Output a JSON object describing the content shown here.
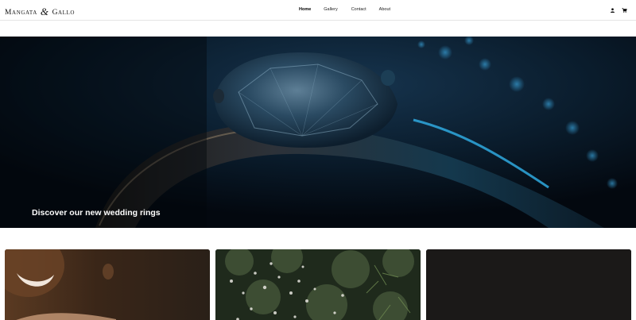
{
  "header": {
    "logo_left": "Mangata",
    "logo_amp": "&",
    "logo_right": "Gallo",
    "nav": [
      {
        "label": "Home",
        "active": true
      },
      {
        "label": "Gallery",
        "active": false
      },
      {
        "label": "Contact",
        "active": false
      },
      {
        "label": "About",
        "active": false
      }
    ],
    "icons": [
      "user-icon",
      "cart-icon"
    ]
  },
  "hero": {
    "caption": "Discover our new wedding rings",
    "image": "diamond-ring-closeup"
  },
  "cards": [
    {
      "image": "smiling-woman-hand-ring"
    },
    {
      "image": "garden-foliage-flowers"
    },
    {
      "image": "dark-plain-background"
    }
  ],
  "colors": {
    "header_bg": "#ffffff",
    "hero_bg": "#05101a",
    "hero_accent": "#2aa8e0",
    "caption": "#ffffff"
  }
}
